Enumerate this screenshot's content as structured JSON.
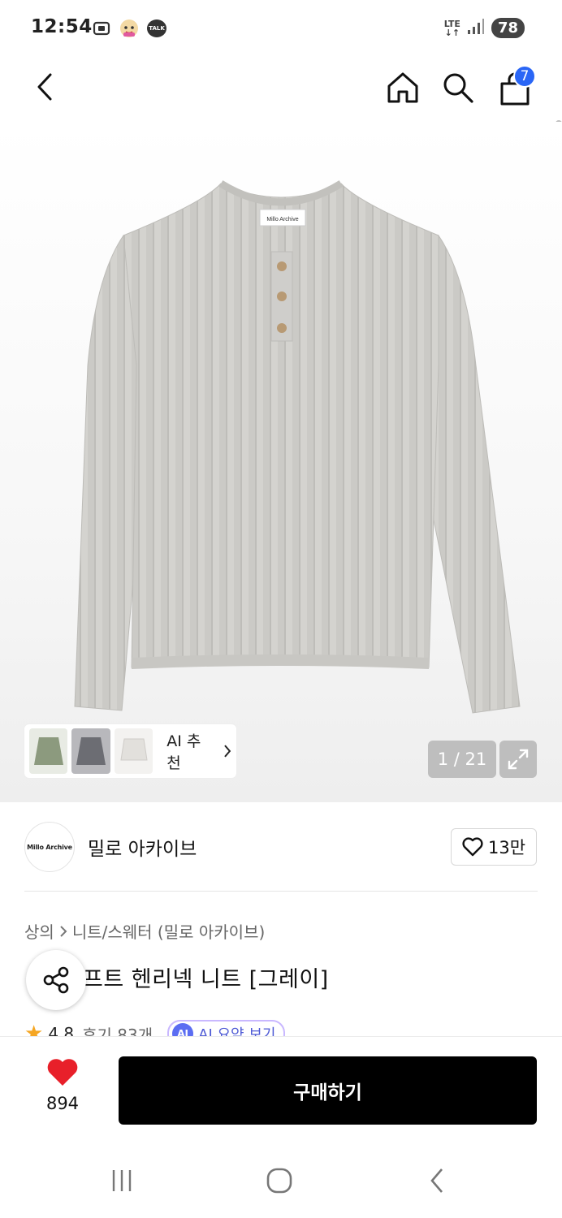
{
  "status_bar": {
    "time": "12:54",
    "talk_label": "TALK",
    "network": "LTE",
    "battery": "78"
  },
  "header": {
    "cart_badge": "7"
  },
  "hero": {
    "tag_text": "Millo Archive",
    "ai_recommend_label": "AI 추천",
    "image_counter": "1 / 21"
  },
  "brand": {
    "logo_text": "Millo Archive",
    "name": "밀로 아카이브",
    "likes": "13만"
  },
  "product": {
    "breadcrumb": [
      "상의",
      "니트/스웨터 (밀로 아카이브)"
    ],
    "title": "프트 헨리넥 니트 [그레이]",
    "rating": "4.8",
    "reviews": "후기 83개",
    "ai_summary_badge": "AI",
    "ai_summary": "AI 요약 보기"
  },
  "purchase": {
    "wish_count": "894",
    "buy_label": "구매하기"
  },
  "colors": {
    "accent": "#2a66f6",
    "heart": "#e8202a",
    "buy_button": "#000000",
    "rating_star": "#f5a623"
  }
}
